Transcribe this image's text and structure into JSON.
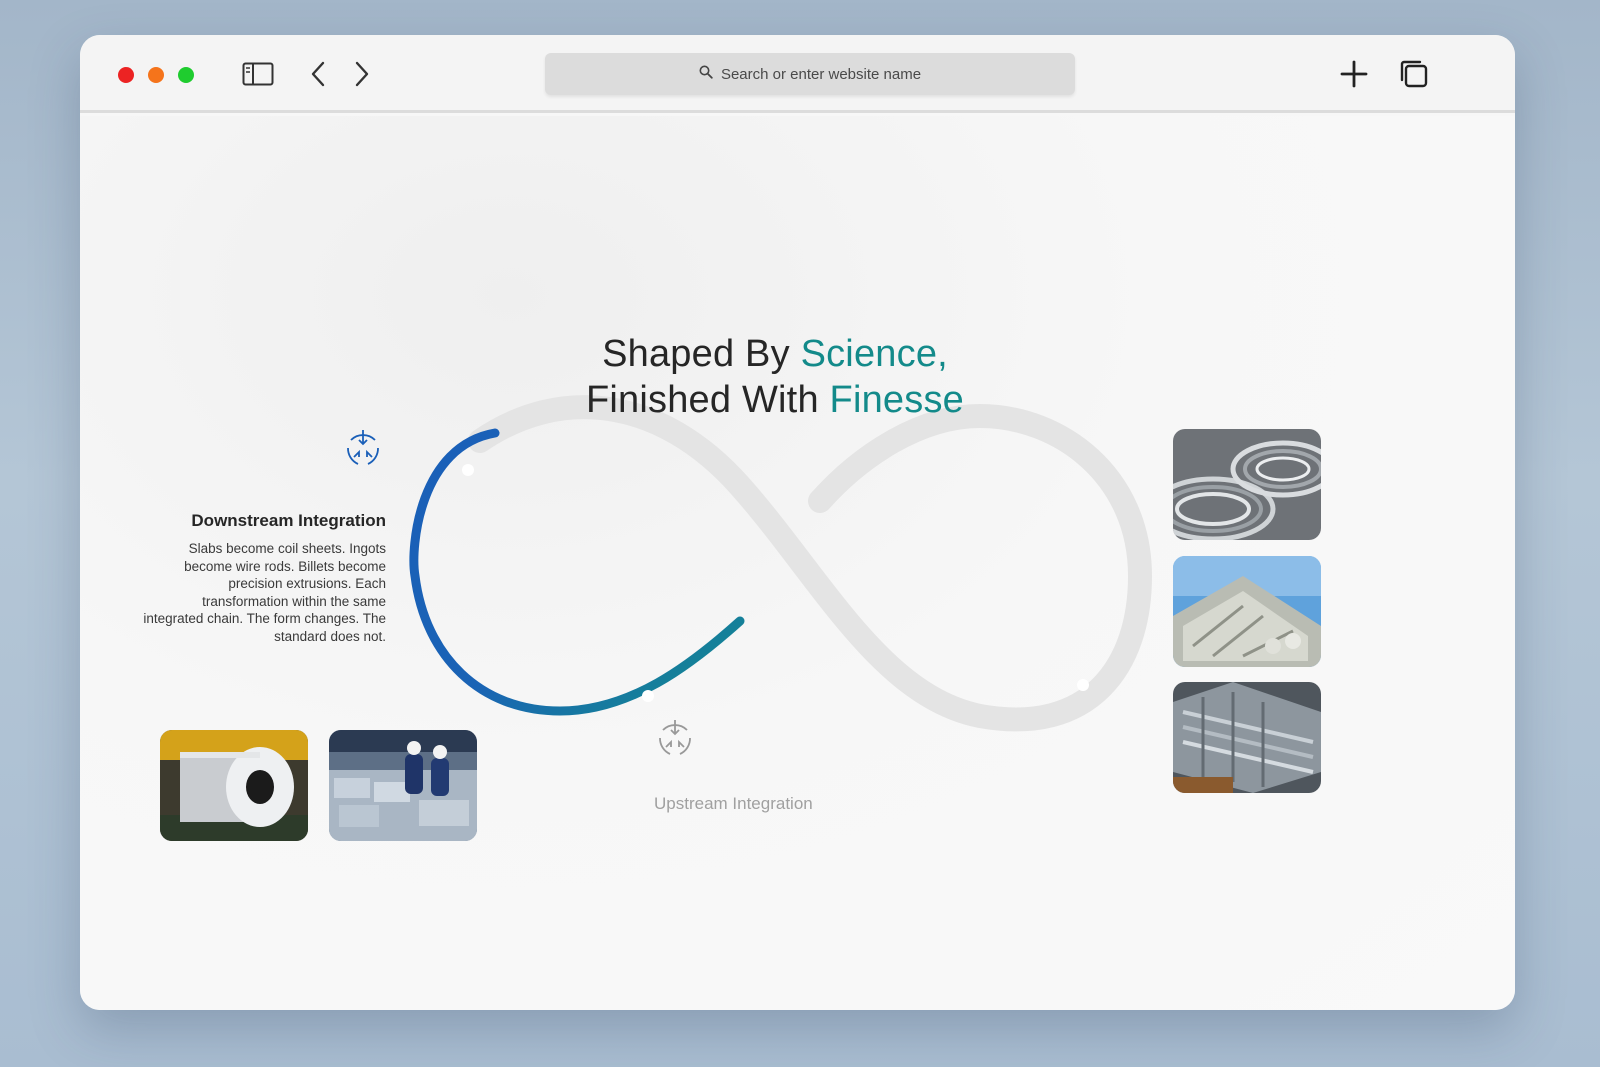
{
  "browser": {
    "window_controls": [
      "close",
      "minimize",
      "zoom"
    ],
    "address_bar": {
      "placeholder": "Search or enter website name",
      "icon": "search-icon"
    },
    "toolbar_icons": [
      "sidebar-icon",
      "back-icon",
      "forward-icon",
      "new-tab-icon",
      "tabs-overview-icon"
    ]
  },
  "hero": {
    "line1_prefix": "Shaped By ",
    "line1_accent": "Science,",
    "line2_prefix": "Finished With ",
    "line2_accent": "Finesse"
  },
  "downstream": {
    "title": "Downstream Integration",
    "body": "Slabs become coil sheets. Ingots become wire rods. Billets become precision extrusions. Each transformation within the same integrated chain. The form changes. The standard does not.",
    "icon": "converge-arrows-icon"
  },
  "upstream": {
    "title": "Upstream Integration",
    "icon": "converge-arrows-icon"
  },
  "colors": {
    "accent_teal": "#138a8a",
    "loop_blue": "#1a63b5",
    "loop_grey": "#e2e2e2"
  },
  "images": [
    "aluminium-coil-photo",
    "workers-inspecting-sheets-photo",
    "wire-coils-photo",
    "stacked-ingots-photo",
    "extrusion-profiles-photo"
  ]
}
